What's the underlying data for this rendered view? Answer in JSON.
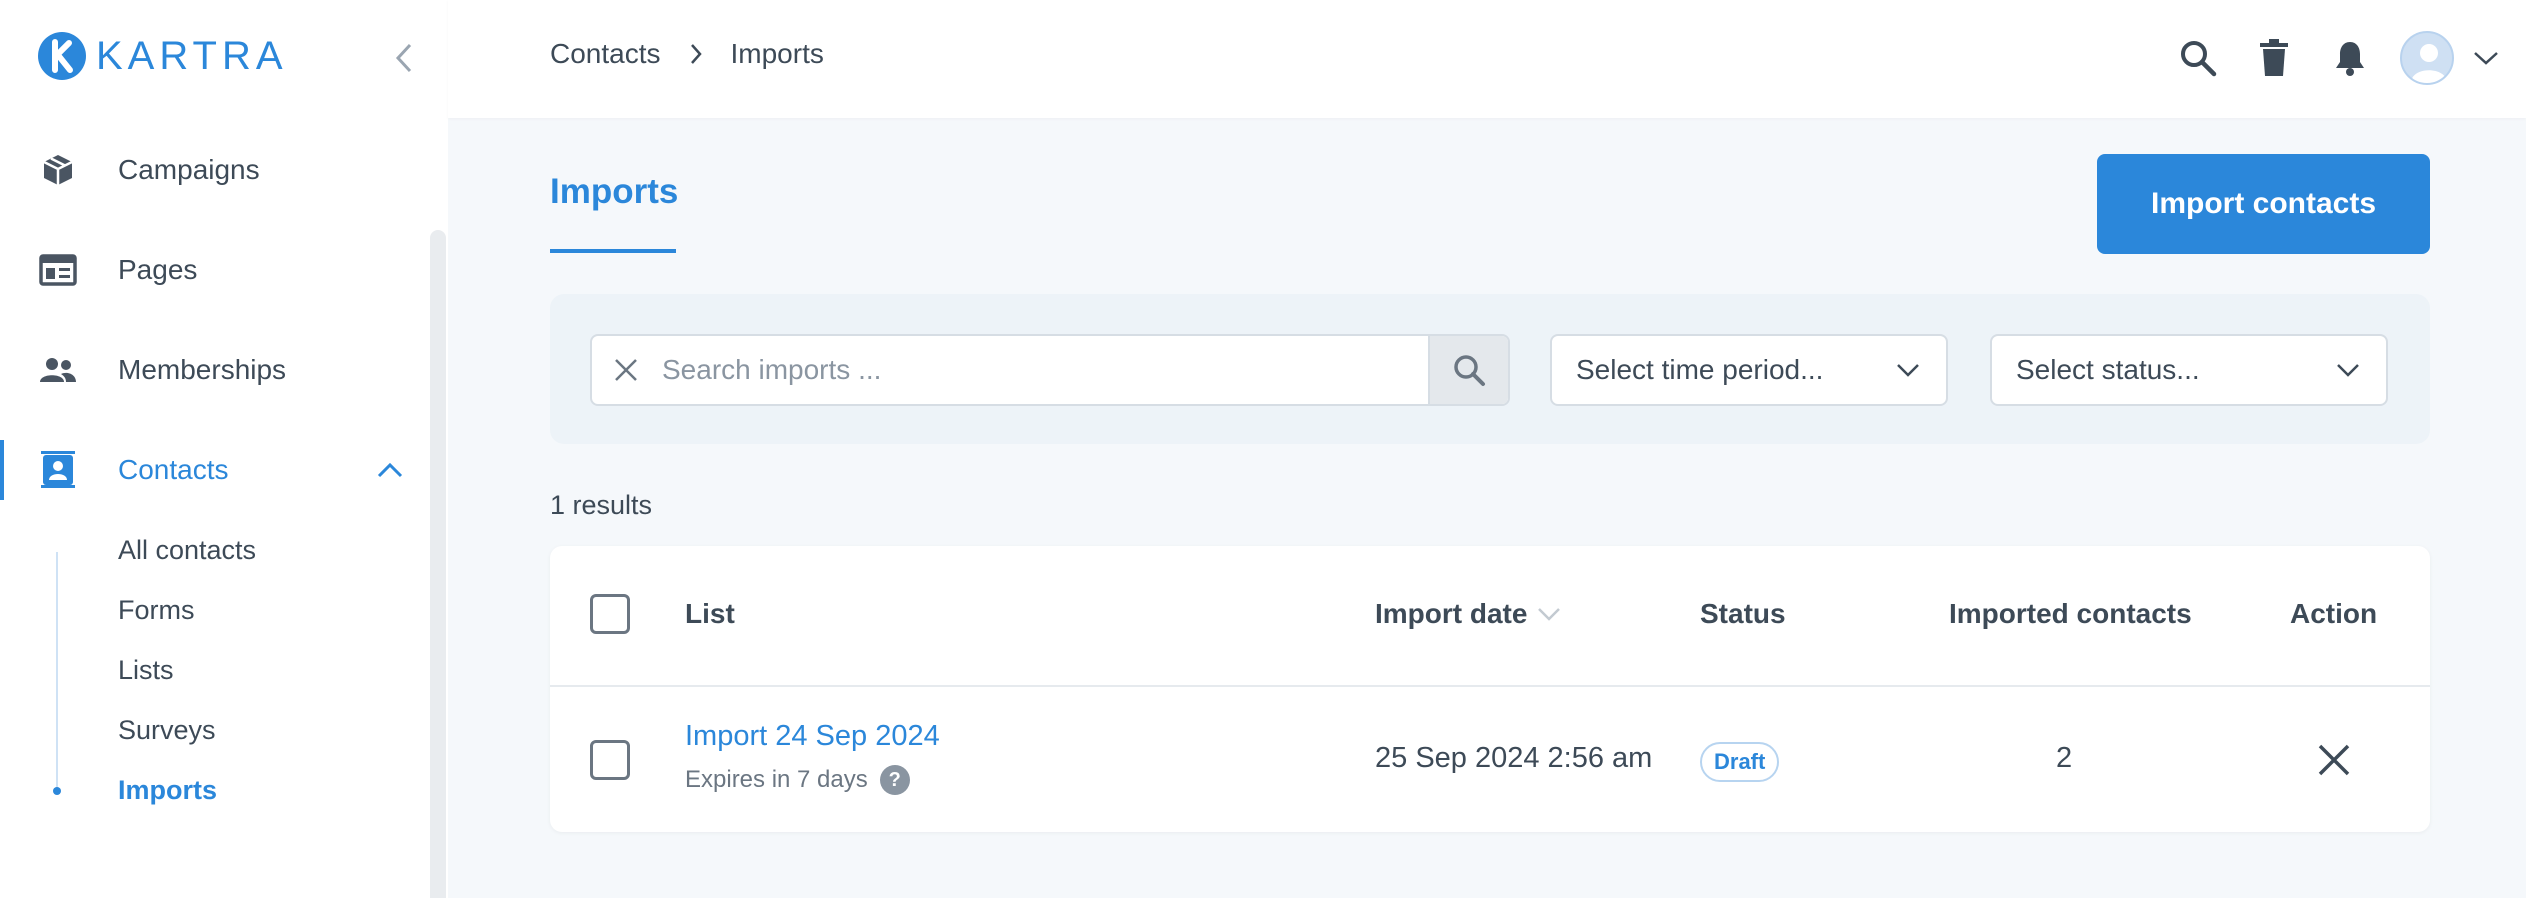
{
  "brand": {
    "name": "KARTRA",
    "accent": "#2b87da"
  },
  "sidebar": {
    "items": [
      {
        "label": "Campaigns",
        "icon": "campaigns-icon"
      },
      {
        "label": "Pages",
        "icon": "pages-icon"
      },
      {
        "label": "Memberships",
        "icon": "memberships-icon"
      },
      {
        "label": "Contacts",
        "icon": "contacts-icon",
        "active": true
      }
    ],
    "contacts_sub": [
      "All contacts",
      "Forms",
      "Lists",
      "Surveys",
      "Imports"
    ]
  },
  "breadcrumb": [
    "Contacts",
    "Imports"
  ],
  "page": {
    "tab": "Imports",
    "import_button": "Import contacts"
  },
  "filters": {
    "search_placeholder": "Search imports ...",
    "time_period": "Select time period...",
    "status": "Select status..."
  },
  "results_text": "1 results",
  "table": {
    "headers": {
      "list": "List",
      "import_date": "Import date",
      "status": "Status",
      "imported_contacts": "Imported contacts",
      "action": "Action"
    },
    "rows": [
      {
        "name": "Import 24 Sep 2024",
        "expires": "Expires in 7 days",
        "help": "?",
        "date": "25 Sep 2024 2:56 am",
        "status": "Draft",
        "count": "2"
      }
    ]
  }
}
